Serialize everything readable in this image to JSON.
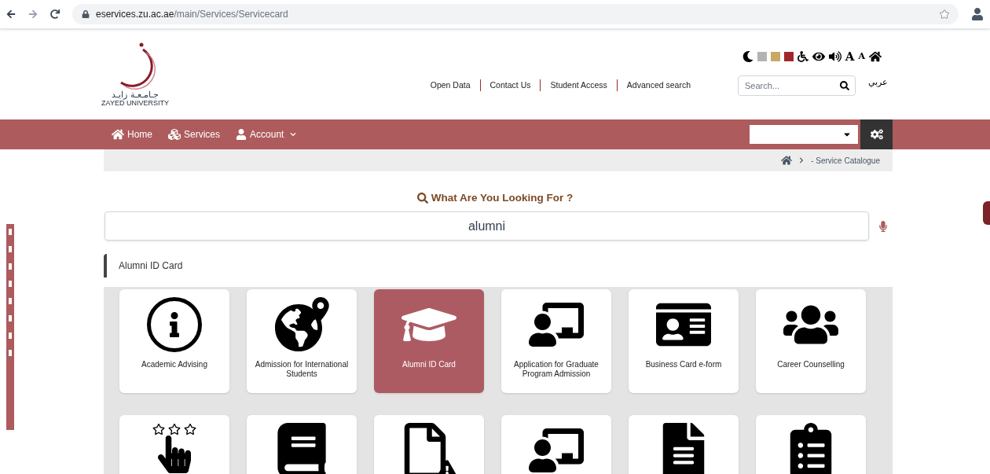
{
  "browser": {
    "url_host": "eservices.zu.ac.ae",
    "url_path": "/main/Services/Servicecard"
  },
  "logo": {
    "arabic": "جـامـعـة زايـد",
    "english": "ZAYED UNIVERSITY"
  },
  "accessibility": {
    "swatches": [
      {
        "color": "#b3b3b3"
      },
      {
        "color": "#c9a862"
      },
      {
        "color": "#a0282b"
      }
    ],
    "large_font": "A",
    "small_font": "A"
  },
  "top_links": [
    "Open Data",
    "Contact Us",
    "Student Access",
    "Advanced search"
  ],
  "site_search": {
    "placeholder": "Search..."
  },
  "language": "عربي",
  "nav": [
    {
      "label": "Home",
      "kind": "home"
    },
    {
      "label": "Services",
      "kind": "services"
    },
    {
      "label": "Account",
      "kind": "account"
    }
  ],
  "breadcrumb": {
    "current": "- Service Catalogue"
  },
  "heading": "What Are You Looking For ?",
  "service_search": {
    "value": "alumni"
  },
  "suggestions": [
    "Alumni ID Card"
  ],
  "services": [
    {
      "label": "Academic Advising",
      "selected": false
    },
    {
      "label": "Admission for International Students",
      "selected": false
    },
    {
      "label": "Alumni ID Card",
      "selected": true
    },
    {
      "label": "Application for Graduate Program Admission",
      "selected": false
    },
    {
      "label": "Business Card e-form",
      "selected": false
    },
    {
      "label": "Career Counselling",
      "selected": false
    },
    {
      "selected": false
    },
    {
      "selected": false
    },
    {
      "selected": false
    },
    {
      "selected": false
    },
    {
      "selected": false
    },
    {
      "selected": false
    }
  ]
}
